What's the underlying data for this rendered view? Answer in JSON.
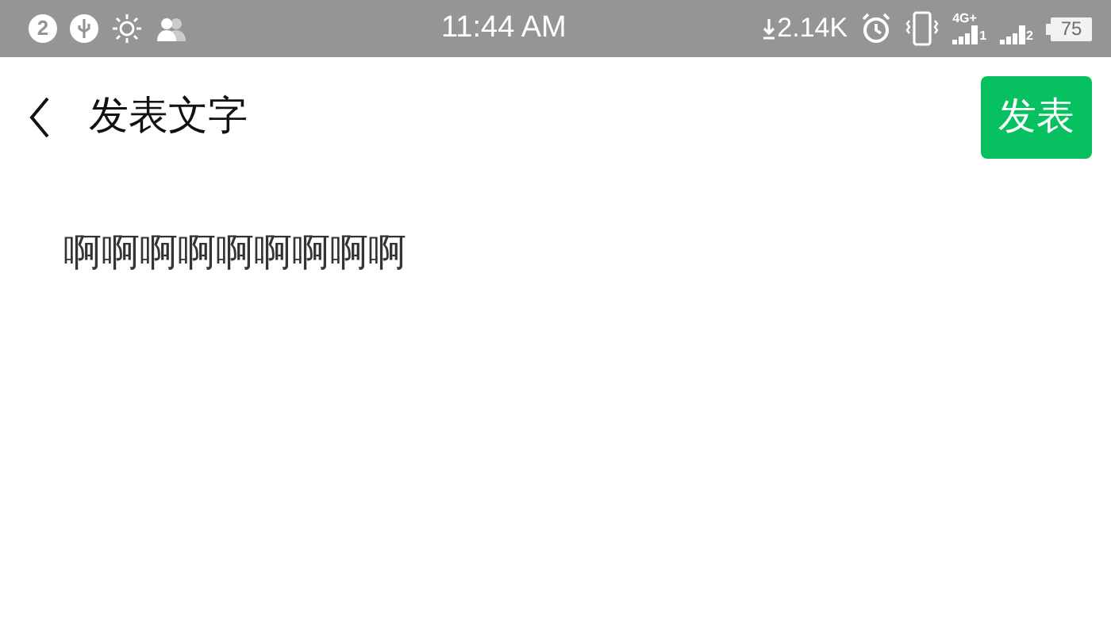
{
  "status_bar": {
    "notification_count": "2",
    "time": "11:44 AM",
    "download_speed": "2.14K",
    "sims": [
      {
        "network": "4G+",
        "slot": "1"
      },
      {
        "slot": "2"
      }
    ],
    "battery": "75"
  },
  "header": {
    "title": "发表文字",
    "publish_button": "发表"
  },
  "body": {
    "text": "啊啊啊啊啊啊啊啊啊"
  }
}
